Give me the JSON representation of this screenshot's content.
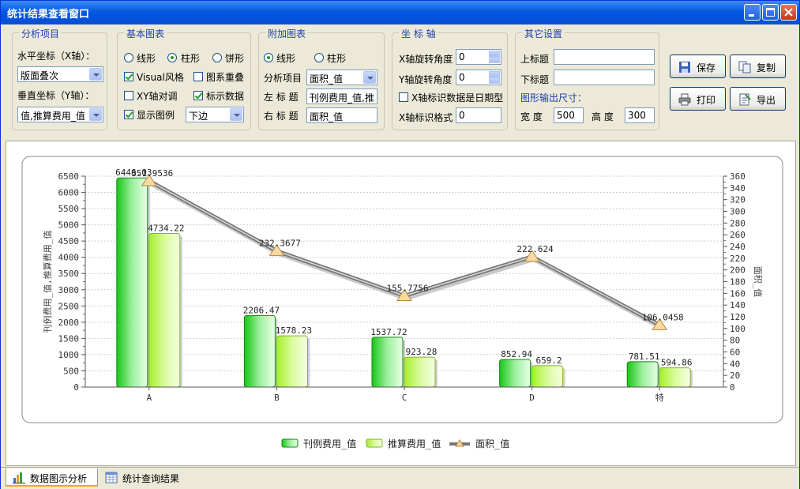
{
  "window": {
    "title": "统计结果查看窗口"
  },
  "groups": {
    "analysis": {
      "title": "分析项目",
      "x_label": "水平坐标（X轴）：",
      "x_value": "版面叠次",
      "y_label": "垂直坐标（Y轴）：",
      "y_value": "值,推算费用_值"
    },
    "basic": {
      "title": "基本图表",
      "line": "线形",
      "bar": "柱形",
      "pie": "饼形",
      "visual": "Visual风格",
      "overlap": "图系重叠",
      "xy_swap": "XY轴对调",
      "show_data": "标示数据",
      "show_legend": "显示图例",
      "legend_pos": "下边"
    },
    "extra": {
      "title": "附加图表",
      "line": "线形",
      "bar": "柱形",
      "item_label": "分析项目",
      "item_value": "面积_值",
      "left_label": "左 标 题",
      "left_value": "刊例费用_值,推",
      "right_label": "右 标 题",
      "right_value": "面积_值"
    },
    "axis": {
      "title": "坐 标 轴",
      "x_rot_label": "X轴旋转角度",
      "x_rot": "0",
      "y_rot_label": "Y轴旋转角度",
      "y_rot": "0",
      "date_label": "X轴标识数据是日期型",
      "fmt_label": "X轴标识格式",
      "fmt_value": "0"
    },
    "other": {
      "title": "其它设置",
      "top_label": "上标题",
      "top_value": "",
      "bottom_label": "下标题",
      "bottom_value": "",
      "size_label": "图形输出尺寸：",
      "width_label": "宽  度",
      "width_value": "500",
      "height_label": "高  度",
      "height_value": "300"
    }
  },
  "buttons": {
    "save": "保存",
    "copy": "复制",
    "print": "打印",
    "export": "导出"
  },
  "tabs": {
    "chart": "数据图示分析",
    "query": "统计查询结果"
  },
  "chart_data": {
    "type": "bar",
    "categories": [
      "A",
      "B",
      "C",
      "D",
      "特"
    ],
    "series": [
      {
        "name": "刊例费用_值",
        "values": [
          6446.03,
          2206.47,
          1537.72,
          852.94,
          781.51
        ],
        "labels": [
          "6446.03",
          "2206.47",
          "1537.72",
          "852.94",
          "781.51"
        ],
        "color": "#22c322"
      },
      {
        "name": "推算费用_值",
        "values": [
          4734.22,
          1578.23,
          923.28,
          659.2,
          594.86
        ],
        "labels": [
          "4734.22",
          "1578.23",
          "923.28",
          "659.2",
          "594.86"
        ],
        "color": "#b6f23a"
      }
    ],
    "line_series": {
      "name": "面积_值",
      "type": "line",
      "values": [
        351.9536,
        232.3677,
        155.7756,
        222.624,
        106.0458
      ],
      "labels": [
        "351.9536",
        "232.3677",
        "155.7756",
        "222.624",
        "106.0458"
      ],
      "color": "#888888",
      "axis": "right"
    },
    "ylabel": "刊例费用_值,推算费用_值",
    "ylabel_right": "面积_值",
    "ylim": [
      0,
      6500
    ],
    "ylim_right": [
      0,
      360
    ],
    "grid": true,
    "legend": "bottom"
  }
}
